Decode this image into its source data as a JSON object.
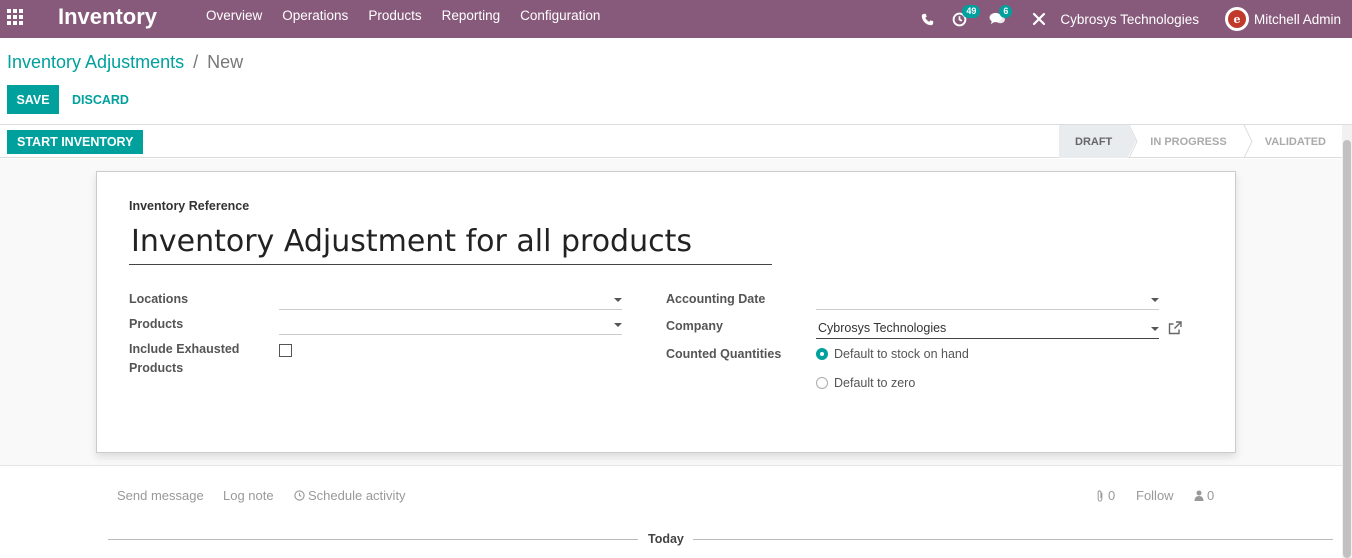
{
  "navbar": {
    "app_title": "Inventory",
    "menu": [
      "Overview",
      "Operations",
      "Products",
      "Reporting",
      "Configuration"
    ],
    "activity_count": "49",
    "message_count": "6",
    "company": "Cybrosys Technologies",
    "user": "Mitchell Admin",
    "bg_color": "#875a7b"
  },
  "breadcrumb": {
    "parent": "Inventory Adjustments",
    "separator": "/",
    "current": "New"
  },
  "buttons": {
    "save": "SAVE",
    "discard": "DISCARD",
    "start_inventory": "START INVENTORY"
  },
  "stages": [
    "DRAFT",
    "IN PROGRESS",
    "VALIDATED"
  ],
  "active_stage": "DRAFT",
  "form": {
    "reference_label": "Inventory Reference",
    "reference_value": "Inventory Adjustment for all products",
    "locations_label": "Locations",
    "locations_value": "",
    "products_label": "Products",
    "products_value": "",
    "include_exhausted_label_1": "Include Exhausted",
    "include_exhausted_label_2": "Products",
    "include_exhausted_checked": false,
    "accounting_date_label": "Accounting Date",
    "accounting_date_value": "",
    "company_label": "Company",
    "company_value": "Cybrosys Technologies",
    "counted_quantities_label": "Counted Quantities",
    "counted_options": [
      "Default to stock on hand",
      "Default to zero"
    ],
    "counted_selected": "Default to stock on hand"
  },
  "chatter": {
    "send_message": "Send message",
    "log_note": "Log note",
    "schedule_activity": "Schedule activity",
    "attachments_count": "0",
    "follow": "Follow",
    "followers_count": "0",
    "today": "Today"
  },
  "colors": {
    "primary": "#00a09d",
    "navbar": "#875a7b"
  }
}
